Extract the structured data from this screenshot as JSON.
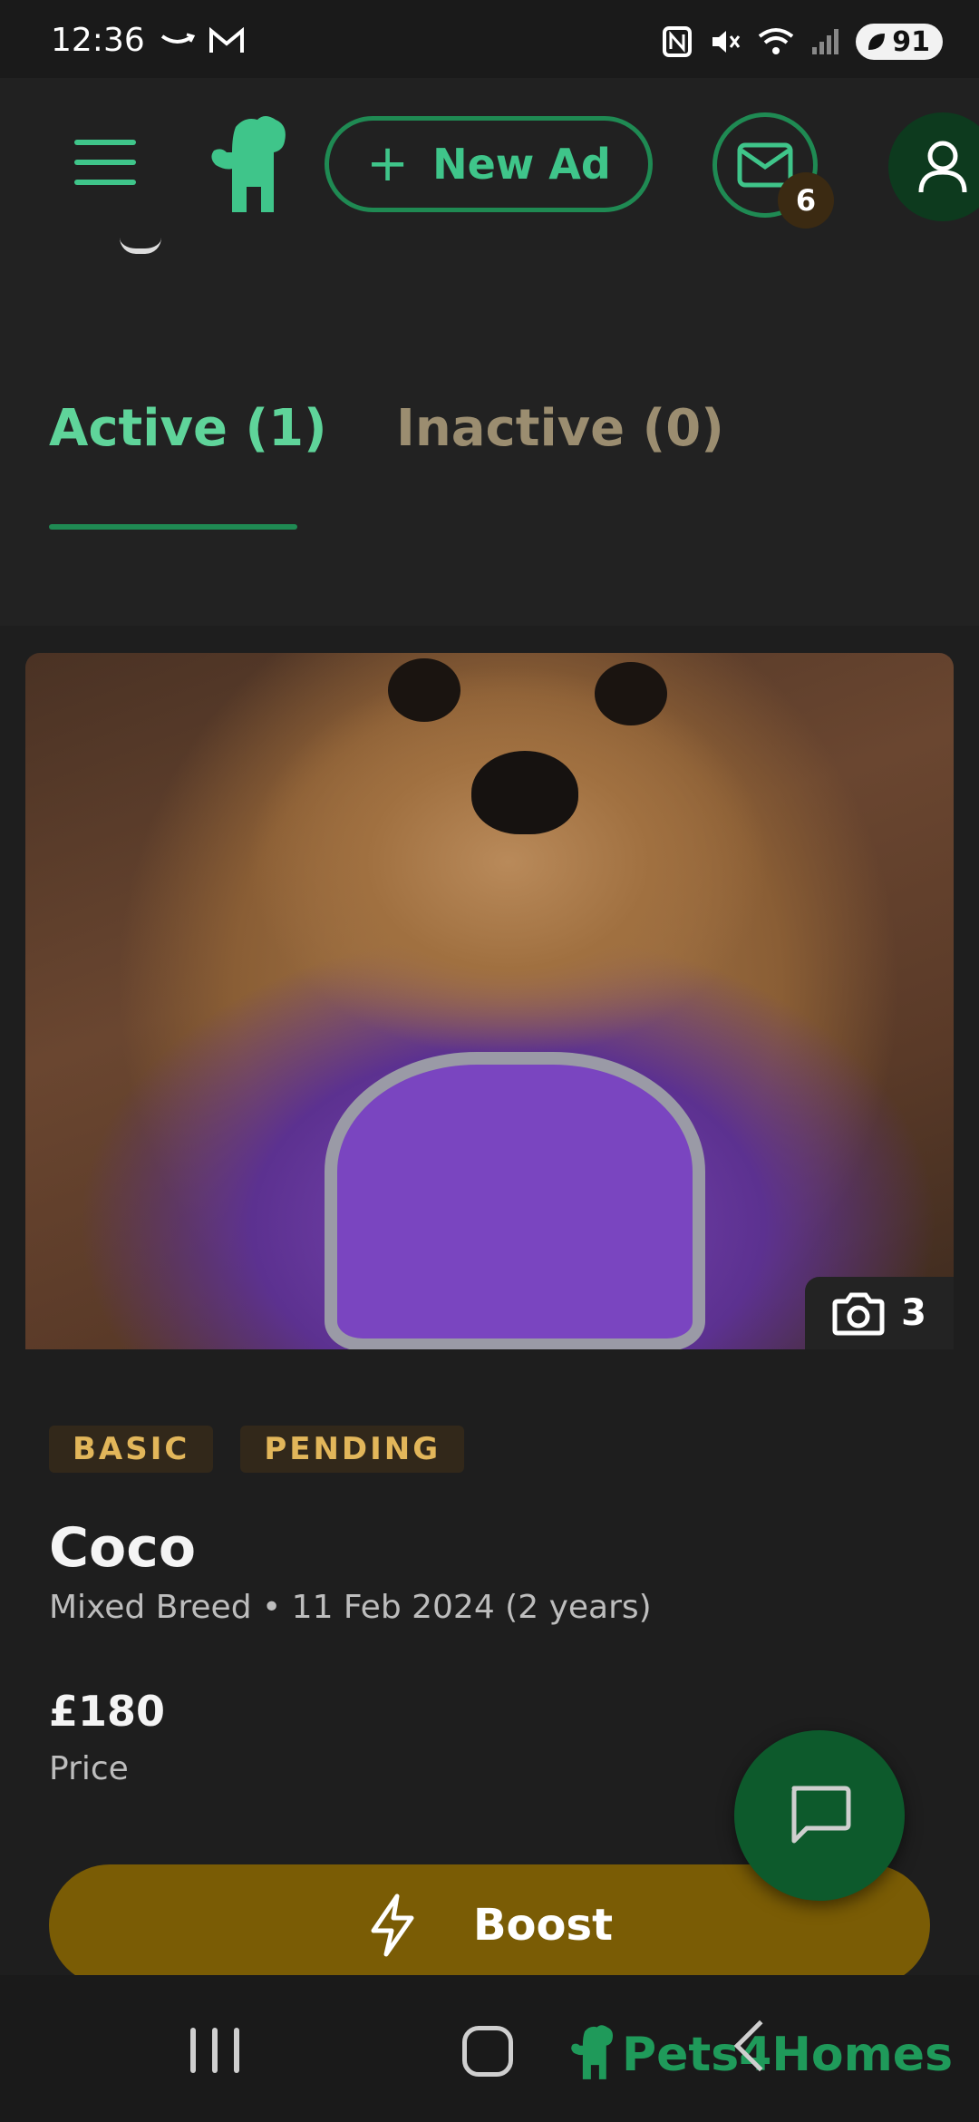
{
  "status_bar": {
    "time": "12:36",
    "battery": "91"
  },
  "header": {
    "new_ad_label": "New Ad",
    "new_ad_icon": "+",
    "messages_badge": "6"
  },
  "tabs": [
    {
      "label": "Active (1)",
      "active": true
    },
    {
      "label": "Inactive (0)",
      "active": false
    }
  ],
  "listing": {
    "photo_count": "3",
    "badges": [
      "BASIC",
      "PENDING"
    ],
    "name": "Coco",
    "meta": "Mixed Breed • 11 Feb 2024 (2 years)",
    "price": "£180",
    "price_label": "Price",
    "boost_label": "Boost"
  },
  "watermark": "Pets4Homes",
  "colors": {
    "accent_green": "#3fc58a",
    "border_green": "#1f8a53",
    "badge_gold": "#e2b65a",
    "boost_bg": "#7a5c05",
    "background": "#222222"
  }
}
